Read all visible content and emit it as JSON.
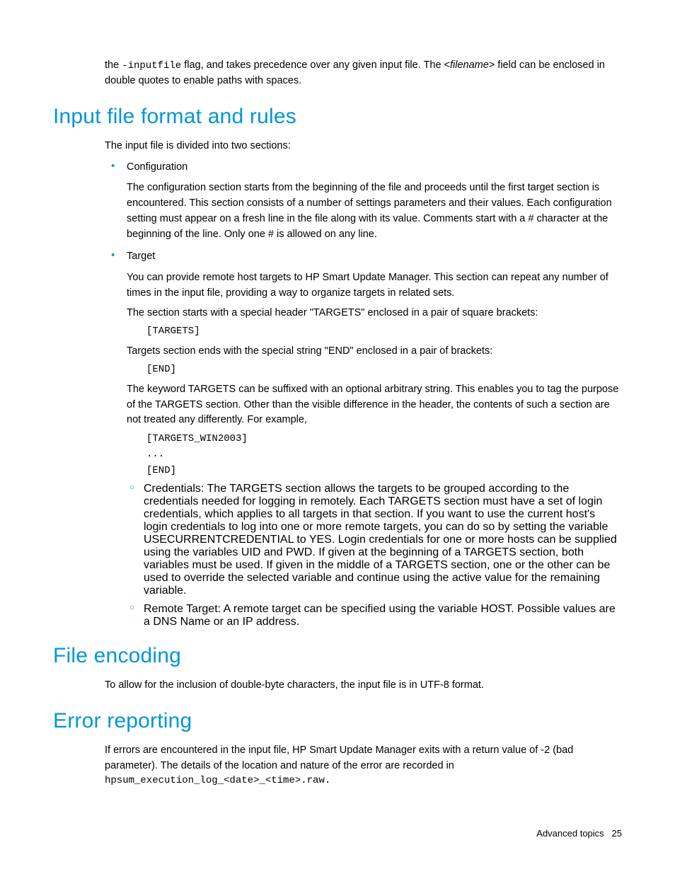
{
  "intro": {
    "pre": "the ",
    "flag": "-inputfile",
    "mid": " flag, and takes precedence over any given input file. The <",
    "fn": "filename",
    "post": "> field can be enclosed in double quotes to enable paths with spaces."
  },
  "s1": {
    "heading": "Input file format and rules",
    "lead": "The input file is divided into two sections:",
    "config": {
      "title": "Configuration",
      "body": "The configuration section starts from the beginning of the file and proceeds until the first target section is encountered. This section consists of a number of settings parameters and their values. Each configuration setting must appear on a fresh line in the file along with its value. Comments start with a # character at the beginning of the line. Only one # is allowed on any line."
    },
    "target": {
      "title": "Target",
      "p1": "You can provide remote host targets to HP Smart Update Manager. This section can repeat any number of times in the input file, providing a way to organize targets in related sets.",
      "p2": "The section starts with a special header \"TARGETS\" enclosed in a pair of square brackets:",
      "code1": "[TARGETS]",
      "p3": "Targets section ends with the special string \"END\" enclosed in a pair of brackets:",
      "code2": "[END]",
      "p4": "The keyword TARGETS can be suffixed with an optional arbitrary string. This enables you to tag the purpose of the TARGETS section. Other than the visible difference in the header, the contents of such a section are not treated any differently. For example,",
      "code3": "[TARGETS_WIN2003]\n...\n[END]",
      "cred": "Credentials: The TARGETS section allows the targets to be grouped according to the credentials needed for logging in remotely. Each TARGETS section must have a set of login credentials, which applies to all targets in that section. If you want to use the current host's login credentials to log into one or more remote targets, you can do so by setting the variable USECURRENTCREDENTIAL to YES. Login credentials for one or more hosts can be supplied using the variables UID and PWD. If given at the beginning of a TARGETS section, both variables must be used. If given in the middle of a TARGETS section, one or the other can be used to override the selected variable and continue using the active value for the remaining variable.",
      "remote": "Remote Target: A remote target can be specified using the variable HOST. Possible values are a DNS Name or an IP address."
    }
  },
  "s2": {
    "heading": "File encoding",
    "body": "To allow for the inclusion of double-byte characters, the input file is in UTF-8 format."
  },
  "s3": {
    "heading": "Error reporting",
    "body": "If errors are encountered in the input file, HP Smart Update Manager exits with a return value of -2 (bad parameter). The details of the location and nature of the error are recorded in",
    "log": "hpsum_execution_log_<date>_<time>.raw",
    "dot": "."
  },
  "footer": {
    "section": "Advanced topics",
    "page": "25"
  }
}
